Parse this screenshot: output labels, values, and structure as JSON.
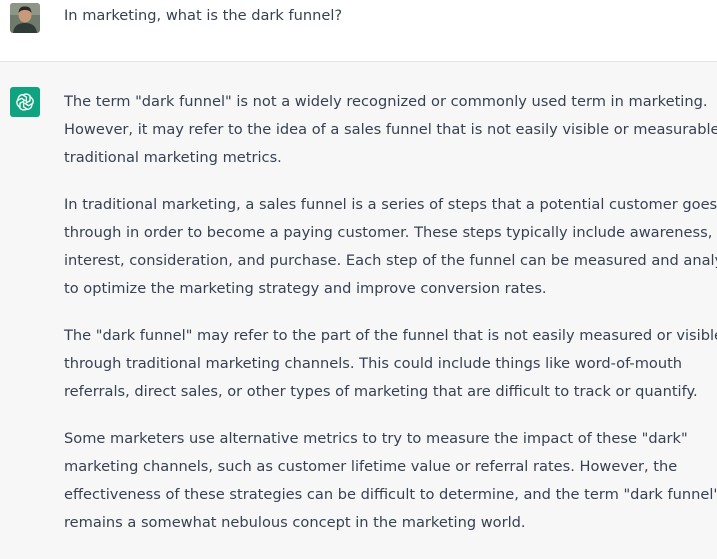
{
  "user": {
    "avatar": "user-avatar",
    "question": "In marketing, what is the dark funnel?"
  },
  "assistant": {
    "icon": "openai-logo-icon",
    "accent": "#10a37f",
    "paragraphs": [
      {
        "lines": [
          "The term \"dark funnel\" is not a widely recognized or commonly used term in marketing.",
          "However, it may refer to the idea of a sales funnel that is not easily visible or measurable by",
          "traditional marketing metrics."
        ]
      },
      {
        "lines": [
          "In traditional marketing, a sales funnel is a series of steps that a potential customer goes",
          "through in order to become a paying customer. These steps typically include awareness,",
          "interest, consideration, and purchase. Each step of the funnel can be measured and analyzed",
          "to optimize the marketing strategy and improve conversion rates."
        ]
      },
      {
        "lines": [
          "The \"dark funnel\" may refer to the part of the funnel that is not easily measured or visible",
          "through traditional marketing channels. This could include things like word-of-mouth",
          "referrals, direct sales, or other types of marketing that are difficult to track or quantify."
        ]
      },
      {
        "lines": [
          "Some marketers use alternative metrics to try to measure the impact of these \"dark\"",
          "marketing channels, such as customer lifetime value or referral rates. However, the",
          "effectiveness of these strategies can be difficult to determine, and the term \"dark funnel\"",
          "remains a somewhat nebulous concept in the marketing world."
        ]
      }
    ]
  }
}
